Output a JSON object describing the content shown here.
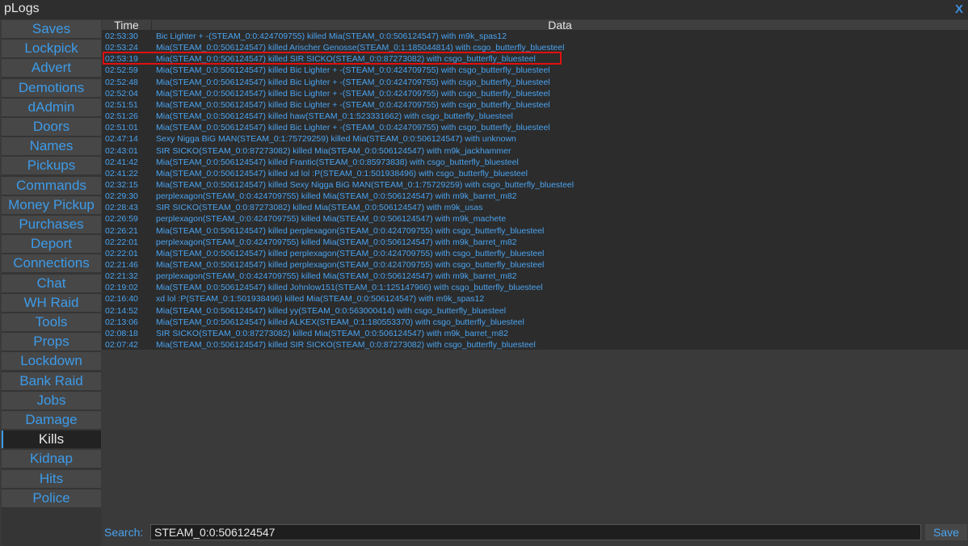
{
  "window": {
    "title": "pLogs",
    "close_label": "X"
  },
  "sidebar": {
    "active": "Kills",
    "items": [
      "Saves",
      "Lockpick",
      "Advert",
      "Demotions",
      "dAdmin",
      "Doors",
      "Names",
      "Pickups",
      "Commands",
      "Money Pickup",
      "Purchases",
      "Deport",
      "Connections",
      "Chat",
      "WH Raid",
      "Tools",
      "Props",
      "Lockdown",
      "Bank Raid",
      "Jobs",
      "Damage",
      "Kills",
      "Kidnap",
      "Hits",
      "Police"
    ]
  },
  "table": {
    "columns": [
      "Time",
      "Data"
    ],
    "highlighted_row": 2,
    "rows": [
      {
        "time": "02:53:30",
        "data": "Bic Lighter + -(STEAM_0:0:424709755) killed Mia(STEAM_0:0:506124547) with m9k_spas12"
      },
      {
        "time": "02:53:24",
        "data": "Mia(STEAM_0:0:506124547) killed Arischer Genosse(STEAM_0:1:185044814) with csgo_butterfly_bluesteel"
      },
      {
        "time": "02:53:19",
        "data": "Mia(STEAM_0:0:506124547) killed SIR SICKO(STEAM_0:0:87273082) with csgo_butterfly_bluesteel"
      },
      {
        "time": "02:52:59",
        "data": "Mia(STEAM_0:0:506124547) killed Bic Lighter + -(STEAM_0:0:424709755) with csgo_butterfly_bluesteel"
      },
      {
        "time": "02:52:48",
        "data": "Mia(STEAM_0:0:506124547) killed Bic Lighter + -(STEAM_0:0:424709755) with csgo_butterfly_bluesteel"
      },
      {
        "time": "02:52:04",
        "data": "Mia(STEAM_0:0:506124547) killed Bic Lighter + -(STEAM_0:0:424709755) with csgo_butterfly_bluesteel"
      },
      {
        "time": "02:51:51",
        "data": "Mia(STEAM_0:0:506124547) killed Bic Lighter + -(STEAM_0:0:424709755) with csgo_butterfly_bluesteel"
      },
      {
        "time": "02:51:26",
        "data": "Mia(STEAM_0:0:506124547) killed haw(STEAM_0:1:523331662) with csgo_butterfly_bluesteel"
      },
      {
        "time": "02:51:01",
        "data": "Mia(STEAM_0:0:506124547) killed Bic Lighter + -(STEAM_0:0:424709755) with csgo_butterfly_bluesteel"
      },
      {
        "time": "02:47:14",
        "data": "Sexy Nigga BiG MAN(STEAM_0:1:75729259) killed Mia(STEAM_0:0:506124547) with unknown"
      },
      {
        "time": "02:43:01",
        "data": "SIR SICKO(STEAM_0:0:87273082) killed Mia(STEAM_0:0:506124547) with m9k_jackhammer"
      },
      {
        "time": "02:41:42",
        "data": "Mia(STEAM_0:0:506124547) killed Frantic(STEAM_0:0:85973838) with csgo_butterfly_bluesteel"
      },
      {
        "time": "02:41:22",
        "data": "Mia(STEAM_0:0:506124547) killed xd lol :P(STEAM_0:1:501938496) with csgo_butterfly_bluesteel"
      },
      {
        "time": "02:32:15",
        "data": "Mia(STEAM_0:0:506124547) killed Sexy Nigga BiG MAN(STEAM_0:1:75729259) with csgo_butterfly_bluesteel"
      },
      {
        "time": "02:29:30",
        "data": "perplexagon(STEAM_0:0:424709755) killed Mia(STEAM_0:0:506124547) with m9k_barret_m82"
      },
      {
        "time": "02:28:43",
        "data": "SIR SICKO(STEAM_0:0:87273082) killed Mia(STEAM_0:0:506124547) with m9k_usas"
      },
      {
        "time": "02:26:59",
        "data": "perplexagon(STEAM_0:0:424709755) killed Mia(STEAM_0:0:506124547) with m9k_machete"
      },
      {
        "time": "02:26:21",
        "data": "Mia(STEAM_0:0:506124547) killed perplexagon(STEAM_0:0:424709755) with csgo_butterfly_bluesteel"
      },
      {
        "time": "02:22:01",
        "data": "perplexagon(STEAM_0:0:424709755) killed Mia(STEAM_0:0:506124547) with m9k_barret_m82"
      },
      {
        "time": "02:22:01",
        "data": "Mia(STEAM_0:0:506124547) killed perplexagon(STEAM_0:0:424709755) with csgo_butterfly_bluesteel"
      },
      {
        "time": "02:21:46",
        "data": "Mia(STEAM_0:0:506124547) killed perplexagon(STEAM_0:0:424709755) with csgo_butterfly_bluesteel"
      },
      {
        "time": "02:21:32",
        "data": "perplexagon(STEAM_0:0:424709755) killed Mia(STEAM_0:0:506124547) with m9k_barret_m82"
      },
      {
        "time": "02:19:02",
        "data": "Mia(STEAM_0:0:506124547) killed Johnlow151(STEAM_0:1:125147966) with csgo_butterfly_bluesteel"
      },
      {
        "time": "02:16:40",
        "data": "xd lol :P(STEAM_0:1:501938496) killed Mia(STEAM_0:0:506124547) with m9k_spas12"
      },
      {
        "time": "02:14:52",
        "data": "Mia(STEAM_0:0:506124547) killed yy(STEAM_0:0:563000414) with csgo_butterfly_bluesteel"
      },
      {
        "time": "02:13:06",
        "data": "Mia(STEAM_0:0:506124547) killed ALKEX(STEAM_0:1:180553370) with csgo_butterfly_bluesteel"
      },
      {
        "time": "02:08:18",
        "data": "SIR SICKO(STEAM_0:0:87273082) killed Mia(STEAM_0:0:506124547) with m9k_barret_m82"
      },
      {
        "time": "02:07:42",
        "data": "Mia(STEAM_0:0:506124547) killed SIR SICKO(STEAM_0:0:87273082) with csgo_butterfly_bluesteel"
      }
    ]
  },
  "search": {
    "label": "Search:",
    "value": "STEAM_0:0:506124547",
    "save_label": "Save"
  },
  "colors": {
    "accent": "#3d9be9",
    "highlight_border": "#e01010",
    "panel": "#2c2c2c",
    "sidebar_item": "#474747"
  }
}
